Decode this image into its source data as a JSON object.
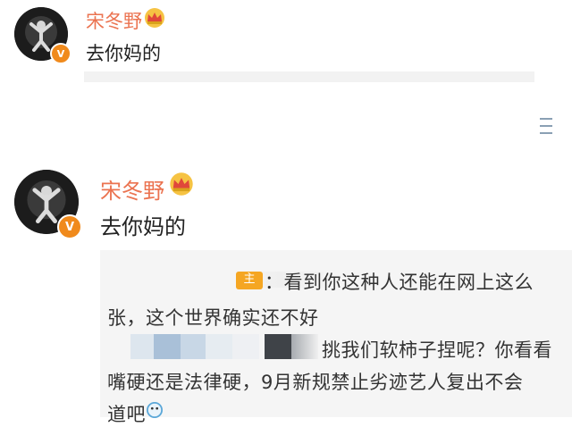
{
  "posts": [
    {
      "username": "宋冬野",
      "message": "去你妈的",
      "badge": "V",
      "crown_icon": "crown-icon",
      "verified_icon": "verified-v-icon"
    },
    {
      "username": "宋冬野",
      "message": "去你妈的",
      "badge": "V",
      "crown_icon": "crown-icon",
      "verified_icon": "verified-v-icon",
      "quote": {
        "tag": "主",
        "line1": "：看到你这种人还能在网上这么",
        "line2": "张，这个世界确实还不好",
        "line3": "挑我们软柿子捏呢？你看看",
        "line4": "嘴硬还是法律硬，9月新规禁止劣迹艺人复出不会",
        "line5": "道吧"
      }
    }
  ],
  "side_icon": "menu-lines-icon",
  "colors": {
    "username": "#eb7350",
    "verified_badge": "#f08a1c",
    "quote_background": "#f5f5f5",
    "tag_background": "#f5a623"
  }
}
